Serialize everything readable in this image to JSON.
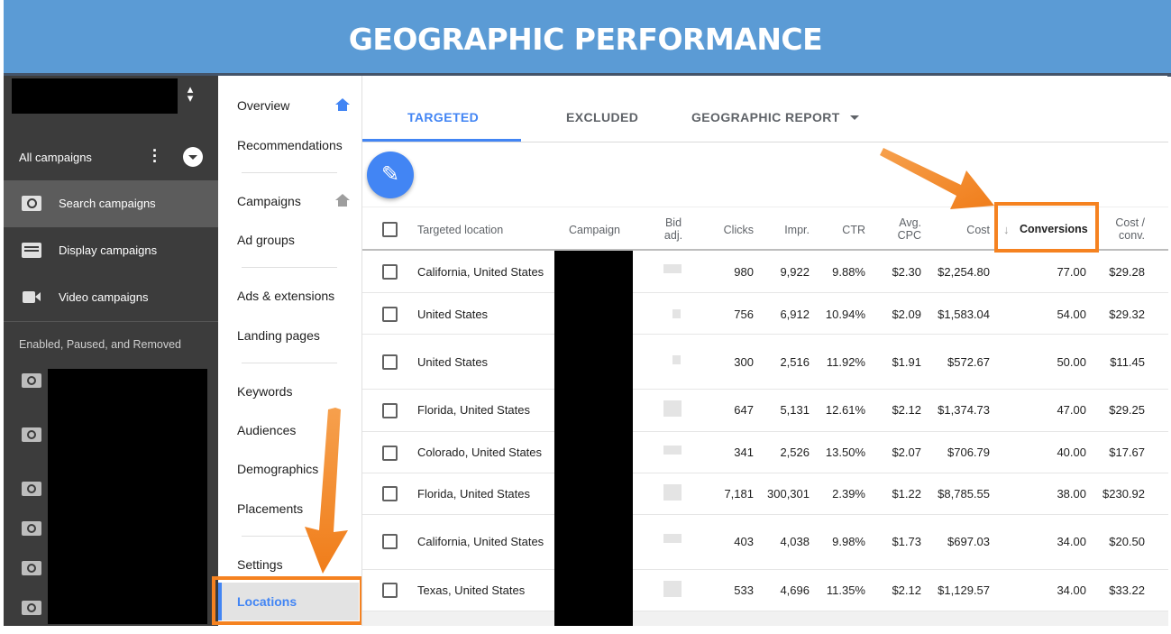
{
  "banner": {
    "title": "GEOGRAPHIC PERFORMANCE"
  },
  "sidebar": {
    "all_campaigns": "All campaigns",
    "items": [
      {
        "label": "Search campaigns",
        "icon": "search-icon"
      },
      {
        "label": "Display campaigns",
        "icon": "display-icon"
      },
      {
        "label": "Video campaigns",
        "icon": "video-icon"
      }
    ],
    "status_filter": "Enabled, Paused, and Removed"
  },
  "nav": {
    "overview": "Overview",
    "recommendations": "Recommendations",
    "campaigns": "Campaigns",
    "ad_groups": "Ad groups",
    "ads_extensions": "Ads & extensions",
    "landing_pages": "Landing pages",
    "keywords": "Keywords",
    "audiences": "Audiences",
    "demographics": "Demographics",
    "placements": "Placements",
    "settings": "Settings",
    "locations": "Locations"
  },
  "tabs": {
    "targeted": "TARGETED",
    "excluded": "EXCLUDED",
    "geographic_report": "GEOGRAPHIC REPORT"
  },
  "table": {
    "headers": {
      "location": "Targeted location",
      "campaign": "Campaign",
      "bid_adj_1": "Bid",
      "bid_adj_2": "adj.",
      "clicks": "Clicks",
      "impr": "Impr.",
      "ctr": "CTR",
      "avg_cpc_1": "Avg.",
      "avg_cpc_2": "CPC",
      "cost": "Cost",
      "conversions": "Conversions",
      "cost_conv_1": "Cost /",
      "cost_conv_2": "conv."
    },
    "rows": [
      {
        "location": "California, United States",
        "clicks": "980",
        "impr": "9,922",
        "ctr": "9.88%",
        "avg_cpc": "$2.30",
        "cost": "$2,254.80",
        "conversions": "77.00",
        "cost_conv": "$29.28"
      },
      {
        "location": "United States",
        "clicks": "756",
        "impr": "6,912",
        "ctr": "10.94%",
        "avg_cpc": "$2.09",
        "cost": "$1,583.04",
        "conversions": "54.00",
        "cost_conv": "$29.32"
      },
      {
        "location": "United States",
        "clicks": "300",
        "impr": "2,516",
        "ctr": "11.92%",
        "avg_cpc": "$1.91",
        "cost": "$572.67",
        "conversions": "50.00",
        "cost_conv": "$11.45"
      },
      {
        "location": "Florida, United States",
        "clicks": "647",
        "impr": "5,131",
        "ctr": "12.61%",
        "avg_cpc": "$2.12",
        "cost": "$1,374.73",
        "conversions": "47.00",
        "cost_conv": "$29.25"
      },
      {
        "location": "Colorado, United States",
        "clicks": "341",
        "impr": "2,526",
        "ctr": "13.50%",
        "avg_cpc": "$2.07",
        "cost": "$706.79",
        "conversions": "40.00",
        "cost_conv": "$17.67"
      },
      {
        "location": "Florida, United States",
        "clicks": "7,181",
        "impr": "300,301",
        "ctr": "2.39%",
        "avg_cpc": "$1.22",
        "cost": "$8,785.55",
        "conversions": "38.00",
        "cost_conv": "$230.92"
      },
      {
        "location": "California, United States",
        "clicks": "403",
        "impr": "4,038",
        "ctr": "9.98%",
        "avg_cpc": "$1.73",
        "cost": "$697.03",
        "conversions": "34.00",
        "cost_conv": "$20.50"
      },
      {
        "location": "Texas, United States",
        "clicks": "533",
        "impr": "4,696",
        "ctr": "11.35%",
        "avg_cpc": "$2.12",
        "cost": "$1,129.57",
        "conversions": "34.00",
        "cost_conv": "$33.22"
      }
    ]
  },
  "colors": {
    "accent": "#4285f4",
    "banner": "#5b9bd5",
    "highlight": "#f58220",
    "sidebar": "#3c3c3c"
  }
}
